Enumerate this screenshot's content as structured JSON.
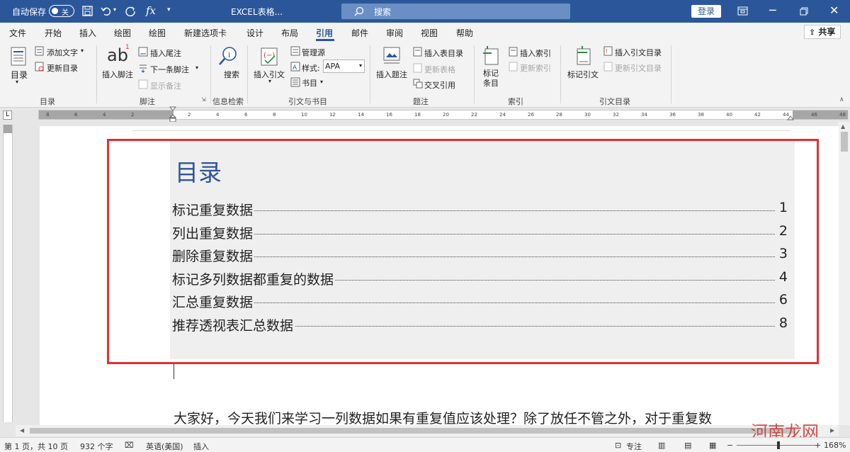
{
  "titlebar": {
    "autosave": "自动保存",
    "toggle": "关",
    "doc_title": "EXCEL表格...",
    "search": "搜索",
    "login": "登录"
  },
  "tabs": [
    "文件",
    "开始",
    "插入",
    "绘图",
    "绘图",
    "新建选项卡",
    "设计",
    "布局",
    "引用",
    "邮件",
    "审阅",
    "视图",
    "帮助"
  ],
  "active_tab": "引用",
  "share": "共享",
  "ribbon": {
    "toc": {
      "btn": "目录",
      "add_text": "添加文字",
      "update": "更新目录",
      "group": "目录"
    },
    "footnote": {
      "insert": "插入脚注",
      "endnote": "插入尾注",
      "next": "下一条脚注",
      "show": "显示备注",
      "group": "脚注"
    },
    "research": {
      "search": "搜索",
      "group": "信息检索"
    },
    "citation": {
      "insert": "插入引文",
      "manage": "管理源",
      "style_label": "样式:",
      "style_value": "APA",
      "bib": "书目",
      "group": "引文与书目"
    },
    "caption": {
      "insert": "插入题注",
      "insert_table": "插入表目录",
      "update_table": "更新表格",
      "crossref": "交叉引用",
      "group": "题注"
    },
    "index": {
      "mark": "标记条目",
      "insert": "插入索引",
      "update": "更新索引",
      "group": "索引"
    },
    "toa": {
      "mark": "标记引文",
      "insert": "插入引文目录",
      "update": "更新引文目录",
      "group": "引文目录"
    }
  },
  "ruler_numbers": [
    "8",
    "6",
    "4",
    "2",
    "",
    "2",
    "4",
    "6",
    "8",
    "10",
    "12",
    "14",
    "16",
    "18",
    "20",
    "22",
    "24",
    "26",
    "28",
    "30",
    "32",
    "34",
    "36",
    "38",
    "40",
    "42",
    "44",
    "46",
    "48"
  ],
  "document": {
    "toc_title": "目录",
    "toc": [
      {
        "title": "标记重复数据",
        "page": "1"
      },
      {
        "title": "列出重复数据",
        "page": "2"
      },
      {
        "title": "删除重复数据",
        "page": "3"
      },
      {
        "title": "标记多列数据都重复的数据",
        "page": "4"
      },
      {
        "title": "汇总重复数据",
        "page": "6"
      },
      {
        "title": "推荐透视表汇总数据",
        "page": "8"
      }
    ],
    "body": "大家好，今天我们来学习一列数据如果有重复值应该处理？除了放任不管之外，对于重复数"
  },
  "status": {
    "page": "第 1 页，共 10 页",
    "words": "932 个字",
    "lang": "英语(美国)",
    "mode": "插入",
    "focus": "专注",
    "zoom": "168%"
  },
  "watermark": "河南龙网",
  "colors": {
    "accent": "#2b579a",
    "highlight": "#e03030"
  }
}
